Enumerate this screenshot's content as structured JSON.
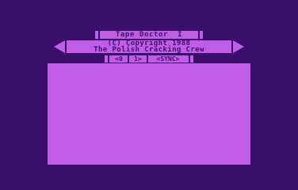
{
  "app": {
    "title": "Tape Doctor  I"
  },
  "banner": {
    "copyright": "(C) Copyright 1988",
    "credits": "The Polish Cracking Crew"
  },
  "menu": {
    "items": [
      {
        "label": "<0"
      },
      {
        "label": "1>"
      },
      {
        "label": "<SYNC>"
      }
    ]
  },
  "colors": {
    "background": "#3a0f6a",
    "foreground": "#c15ce6"
  },
  "icons": {
    "left_arrow": "left-triangle-icon",
    "right_arrow": "right-triangle-icon"
  }
}
